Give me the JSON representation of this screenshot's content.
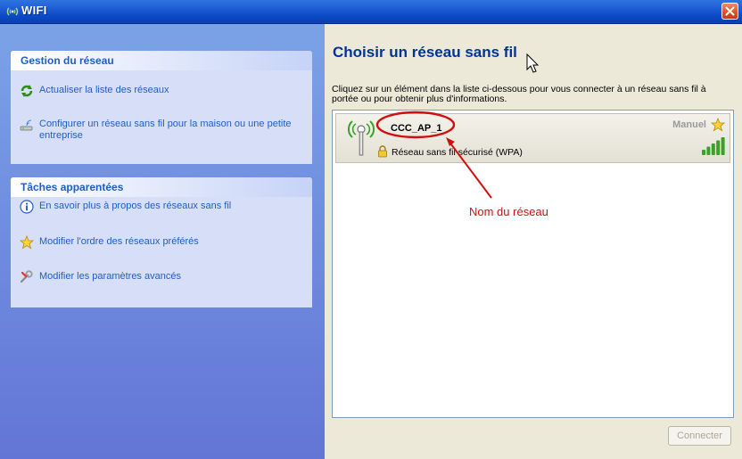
{
  "window": {
    "title": "WIFI"
  },
  "sidebar": {
    "network_tasks": {
      "heading": "Gestion du réseau",
      "items": [
        {
          "label": "Actualiser la liste des réseaux",
          "icon": "refresh-icon"
        },
        {
          "label": "Configurer un réseau sans fil pour la maison ou une petite entreprise",
          "icon": "wireless-setup-icon"
        }
      ]
    },
    "related_tasks": {
      "heading": "Tâches apparentées",
      "items": [
        {
          "label": "En savoir plus à propos des réseaux sans fil",
          "icon": "info-icon"
        },
        {
          "label": "Modifier l'ordre des réseaux préférés",
          "icon": "star-icon"
        },
        {
          "label": "Modifier les paramètres avancés",
          "icon": "settings-icon"
        }
      ]
    }
  },
  "main": {
    "title": "Choisir un réseau sans fil",
    "instructions": "Cliquez sur un élément dans la liste ci-dessous pour vous connecter à un réseau sans fil à portée ou pour obtenir plus d'informations.",
    "networks": [
      {
        "name": "CCC_AP_1",
        "type": "Manuel",
        "security": "Réseau sans fil sécurisé (WPA)",
        "signal_bars": 5
      }
    ],
    "annotation": "Nom du réseau",
    "connect_button": "Connecter"
  },
  "colors": {
    "title_bar": "#0b49c4",
    "sidebar_link": "#215DC6",
    "heading": "#003399",
    "annotation_red": "#d01010"
  }
}
